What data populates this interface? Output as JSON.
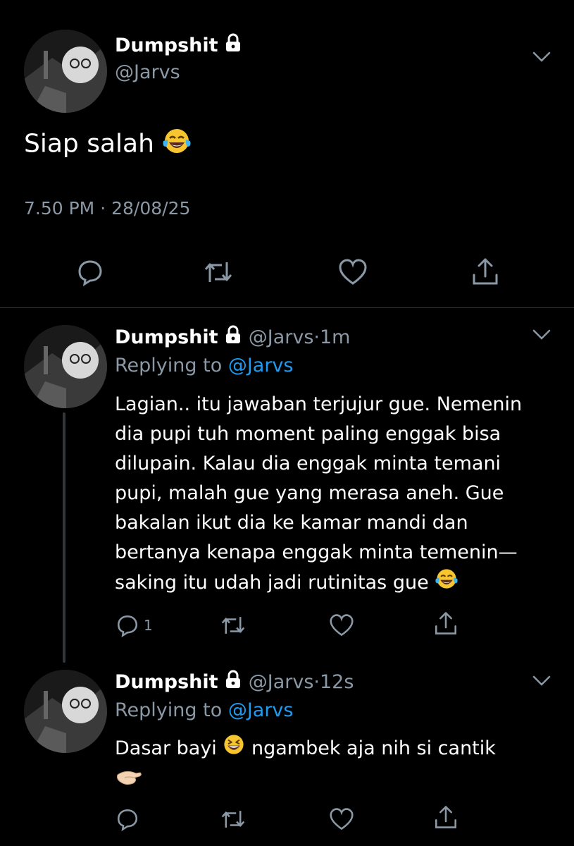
{
  "main_tweet": {
    "display_name": "Dumpshit",
    "handle": "@Jarvs",
    "text": "Siap salah",
    "time": "7.50 PM",
    "separator": "·",
    "date": "28/08/25"
  },
  "replies": [
    {
      "display_name": "Dumpshit",
      "handle": "@Jarvs",
      "separator": "·",
      "age": "1m",
      "replying_prefix": "Replying to",
      "replying_handle": "@Jarvs",
      "text_lines": [
        "Lagian.. itu jawaban terjujur gue. Nemenin",
        "dia pupi tuh moment paling enggak bisa",
        "dilupain. Kalau dia enggak minta temani",
        "pupi, malah gue yang merasa aneh. Gue",
        "bakalan ikut dia ke kamar mandi dan",
        "bertanya kenapa enggak minta temenin—",
        "saking itu udah jadi rutinitas gue"
      ],
      "reply_count": "1"
    },
    {
      "display_name": "Dumpshit",
      "handle": "@Jarvs",
      "separator": "·",
      "age": "12s",
      "replying_prefix": "Replying to",
      "replying_handle": "@Jarvs",
      "text_part1": "Dasar bayi",
      "text_part2": "ngambek aja nih si cantik"
    }
  ],
  "icons": [
    "lock-icon",
    "chevron-down-icon",
    "reply-icon",
    "retweet-icon",
    "like-icon",
    "share-icon",
    "laughing-tears-emoji",
    "grinning-squint-emoji",
    "pinching-hand-emoji"
  ],
  "colors": {
    "background": "#000000",
    "text": "#e7e9ea",
    "secondary": "#8b98a5",
    "link": "#1d9bf0",
    "divider": "#2f3336"
  }
}
